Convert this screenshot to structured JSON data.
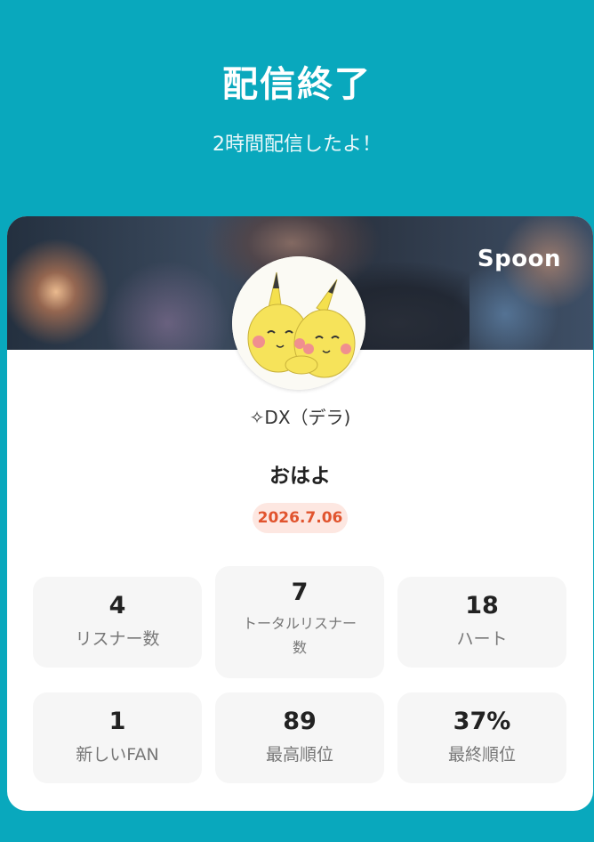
{
  "header": {
    "title": "配信終了",
    "subtitle": "2時間配信したよ！"
  },
  "card": {
    "brand": "Spoon",
    "user_name": "✧DX（デラ)",
    "broadcast_title": "おはよ",
    "date": "2026.7.06",
    "stats": [
      {
        "value": "4",
        "label": "リスナー数"
      },
      {
        "value": "7",
        "label_line1": "トータルリスナー",
        "label_line2": "数"
      },
      {
        "value": "18",
        "label": "ハート"
      },
      {
        "value": "1",
        "label": "新しいFAN"
      },
      {
        "value": "89",
        "label": "最高順位"
      },
      {
        "value": "37%",
        "label": "最終順位"
      }
    ]
  },
  "colors": {
    "background": "#09a8bd",
    "badge_bg": "#fde7e1",
    "badge_text": "#e1542e",
    "stat_bg": "#f6f6f6"
  }
}
